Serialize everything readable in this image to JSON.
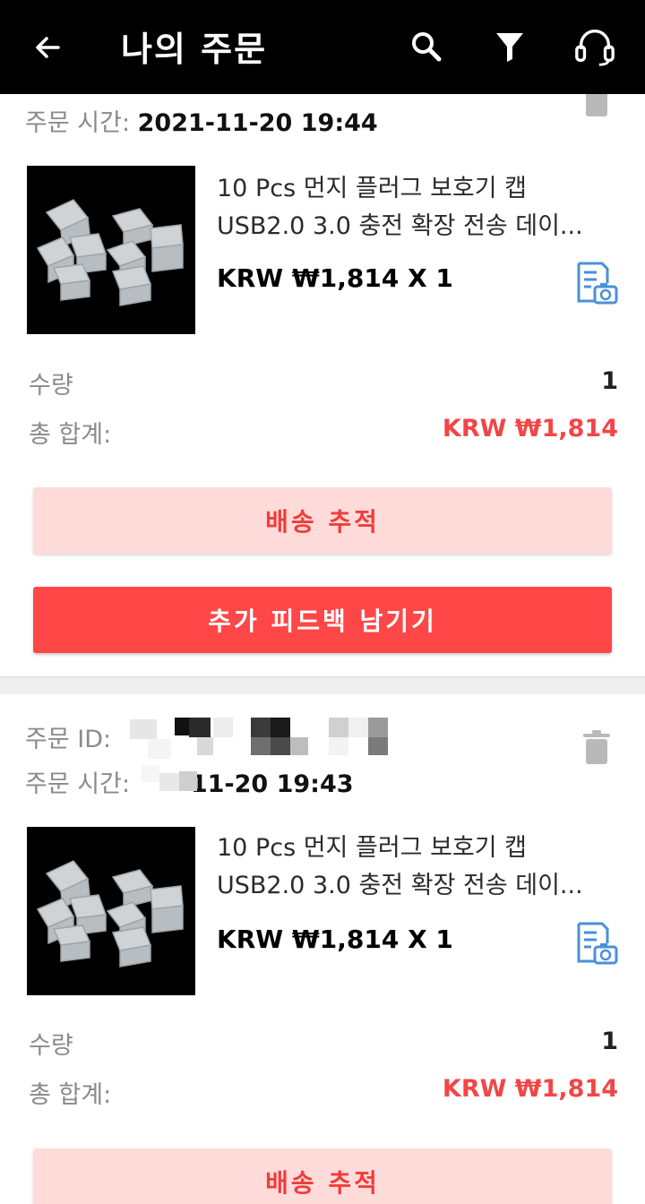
{
  "header": {
    "title": "나의 주문"
  },
  "orders": [
    {
      "time_label": "주문 시간:",
      "time_value": "2021-11-20 19:44",
      "product_title_line1": "10 Pcs 먼지 플러그 보호기 캡",
      "product_title_line2": "USB2.0 3.0 충전 확장 전송 데이...",
      "price": "KRW ₩1,814 X 1",
      "quantity_label": "수량",
      "quantity_value": "1",
      "total_label": "총 합계:",
      "total_value": "KRW ₩1,814",
      "track_button": "배송 추적",
      "feedback_button": "추가 피드백 남기기"
    },
    {
      "id_label": "주문 ID:",
      "time_label": "주문 시간:",
      "time_value": "-11-20 19:43",
      "product_title_line1": "10 Pcs 먼지 플러그 보호기 캡",
      "product_title_line2": "USB2.0 3.0 충전 확장 전송 데이...",
      "price": "KRW ₩1,814 X 1",
      "quantity_label": "수량",
      "quantity_value": "1",
      "total_label": "총 합계:",
      "total_value": "KRW ₩1,814",
      "track_button": "배송 추적"
    }
  ],
  "icons": {
    "back": "back-arrow-icon",
    "search": "search-icon",
    "filter": "filter-icon",
    "support": "headset-icon",
    "receipt": "receipt-camera-icon",
    "delete": "trash-icon"
  },
  "colors": {
    "accent": "#ff4747",
    "accent_light": "#ffdcd9",
    "price_red": "#f24646",
    "receipt_blue": "#4a90d9"
  }
}
